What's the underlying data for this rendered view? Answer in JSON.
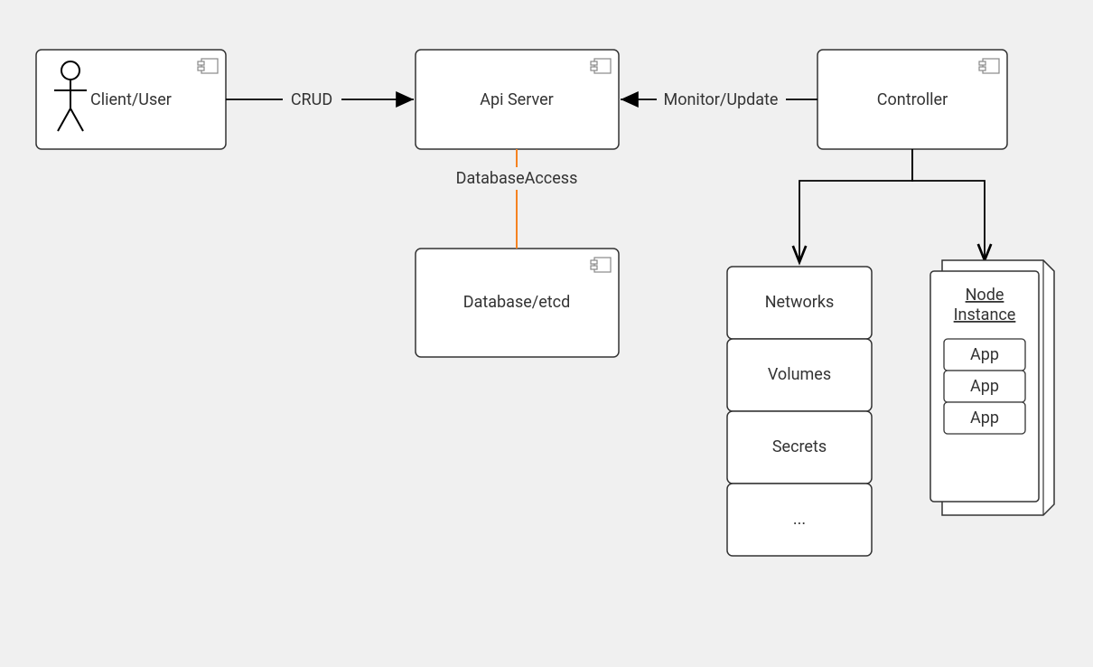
{
  "components": {
    "client": {
      "label": "Client/User"
    },
    "api_server": {
      "label": "Api Server"
    },
    "controller": {
      "label": "Controller"
    },
    "database": {
      "label": "Database/etcd"
    },
    "resources": [
      {
        "label": "Networks"
      },
      {
        "label": "Volumes"
      },
      {
        "label": "Secrets"
      },
      {
        "label": "..."
      }
    ],
    "node_instance": {
      "title": "Node\nInstance",
      "apps": [
        "App",
        "App",
        "App"
      ]
    }
  },
  "edges": {
    "crud": {
      "label": "CRUD"
    },
    "monitor": {
      "label": "Monitor/Update"
    },
    "db_access": {
      "label": "DatabaseAccess"
    }
  }
}
